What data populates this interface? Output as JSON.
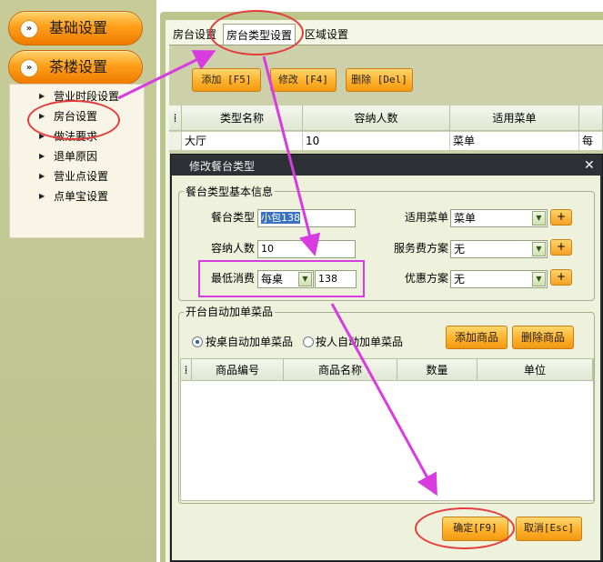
{
  "sidebar": {
    "categories": [
      {
        "label": "基础设置",
        "icon": "double-chevron-right-icon"
      },
      {
        "label": "茶楼设置",
        "icon": "double-chevron-right-icon"
      }
    ],
    "items": [
      {
        "label": "营业时段设置"
      },
      {
        "label": "房台设置"
      },
      {
        "label": "做法要求"
      },
      {
        "label": "退单原因"
      },
      {
        "label": "营业点设置"
      },
      {
        "label": "点单宝设置"
      }
    ]
  },
  "tabs": [
    {
      "label": "房台设置"
    },
    {
      "label": "房台类型设置",
      "active": true
    },
    {
      "label": "区域设置"
    }
  ],
  "toolbar": {
    "add_label": "添加 [F5]",
    "edit_label": "修改 [F4]",
    "delete_label": "删除 [Del]"
  },
  "table": {
    "columns": [
      "类型名称",
      "容纳人数",
      "适用菜单"
    ],
    "rows": [
      {
        "name": "大厅",
        "capacity": "10",
        "menu": "菜单",
        "extra": "每桌"
      }
    ]
  },
  "dialog": {
    "title": "修改餐台类型",
    "basic_group_title": "餐台类型基本信息",
    "fields": {
      "type_label": "餐台类型",
      "type_value": "小包138",
      "capacity_label": "容纳人数",
      "capacity_value": "10",
      "min_charge_label": "最低消费",
      "min_charge_unit": "每桌",
      "min_charge_value": "138",
      "menu_label": "适用菜单",
      "menu_value": "菜单",
      "service_label": "服务费方案",
      "service_value": "无",
      "discount_label": "优惠方案",
      "discount_value": "无",
      "plus_label": "+"
    },
    "auto_group_title": "开台自动加单菜品",
    "radio_per_table": "按桌自动加单菜品",
    "radio_per_person": "按人自动加单菜品",
    "add_goods_label": "添加商品",
    "remove_goods_label": "删除商品",
    "goods_columns": [
      "商品编号",
      "商品名称",
      "数量",
      "单位"
    ],
    "ok_label": "确定[F9]",
    "cancel_label": "取消[Esc]",
    "close_icon": "close-icon"
  },
  "colors": {
    "orange_button": "#ff9f1a",
    "sidebar_bg": "#c7cb98",
    "dialog_title_bg": "#2d3035",
    "annotation_red": "#e63b3b",
    "annotation_magenta": "#d83ce0"
  }
}
